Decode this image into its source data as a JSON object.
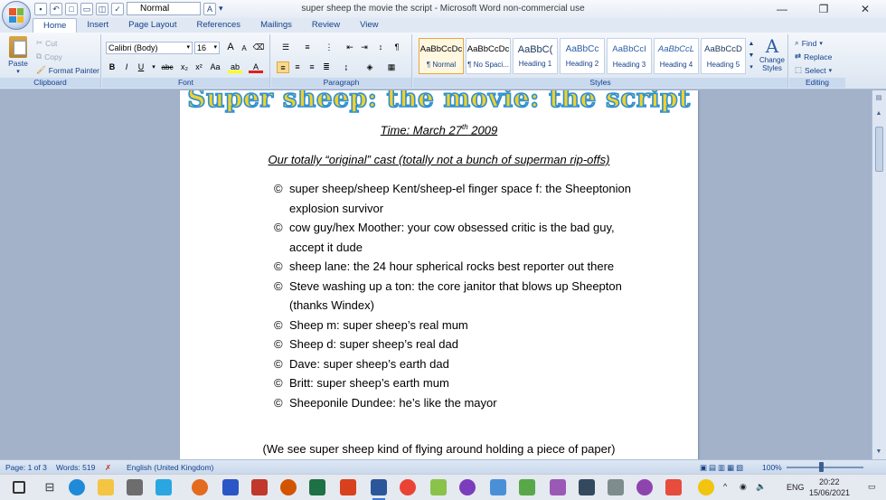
{
  "window": {
    "title": "super sheep the movie the script - Microsoft Word non-commercial use",
    "quick_style": "Normal",
    "controls": [
      "—",
      "❐",
      "✕"
    ]
  },
  "tabs": [
    "Home",
    "Insert",
    "Page Layout",
    "References",
    "Mailings",
    "Review",
    "View"
  ],
  "ribbon": {
    "clipboard": {
      "label": "Clipboard",
      "paste": "Paste",
      "cut": "Cut",
      "copy": "Copy",
      "format_painter": "Format Painter"
    },
    "font": {
      "label": "Font",
      "family": "Calibri (Body)",
      "size": "16",
      "bold": "B",
      "italic": "I",
      "underline": "U",
      "strike": "abc",
      "subscript": "x₂",
      "superscript": "x²",
      "change_case": "Aa",
      "grow": "A",
      "shrink": "A"
    },
    "paragraph": {
      "label": "Paragraph",
      "pilcrow": "¶"
    },
    "styles": {
      "label": "Styles",
      "items": [
        {
          "sample": "AaBbCcDc",
          "name": "¶ Normal"
        },
        {
          "sample": "AaBbCcDc",
          "name": "¶ No Spaci..."
        },
        {
          "sample": "AaBbC(",
          "name": "Heading 1"
        },
        {
          "sample": "AaBbCc",
          "name": "Heading 2"
        },
        {
          "sample": "AaBbCcI",
          "name": "Heading 3"
        },
        {
          "sample": "AaBbCcL",
          "name": "Heading 4"
        },
        {
          "sample": "AaBbCcD",
          "name": "Heading 5"
        }
      ],
      "change_styles": "Change Styles"
    },
    "editing": {
      "label": "Editing",
      "find": "Find",
      "replace": "Replace",
      "select": "Select"
    }
  },
  "document": {
    "title": "Super sheep: the movie: the script",
    "time_label": "Time: March 27",
    "time_sup": "th",
    "time_year": " 2009",
    "cast_heading": "Our totally “original” cast (totally not a bunch of superman rip-offs)",
    "bullet_symbol": "©",
    "cast": [
      "super sheep/sheep Kent/sheep-el finger space f: the Sheeptonion explosion survivor",
      "cow guy/hex Moother: your cow obsessed critic is the bad guy, accept it dude",
      "sheep lane: the 24 hour spherical rocks best reporter out there",
      "Steve washing up a ton: the core janitor that blows up Sheepton (thanks Windex)",
      "Sheep m: super sheep’s  real mum",
      "Sheep d: super sheep’s real dad",
      "Dave: super sheep’s earth dad",
      "Britt: super sheep’s earth mum",
      "Sheeponile Dundee: he’s like the mayor"
    ],
    "scene_line": "(We see super sheep kind of flying around holding a piece of paper)"
  },
  "status": {
    "page": "Page: 1 of 3",
    "words": "Words: 519",
    "language": "English (United Kingdom)",
    "zoom": "100%"
  },
  "taskbar": {
    "language": "ENG",
    "time": "20:22",
    "date": "15/06/2021"
  }
}
